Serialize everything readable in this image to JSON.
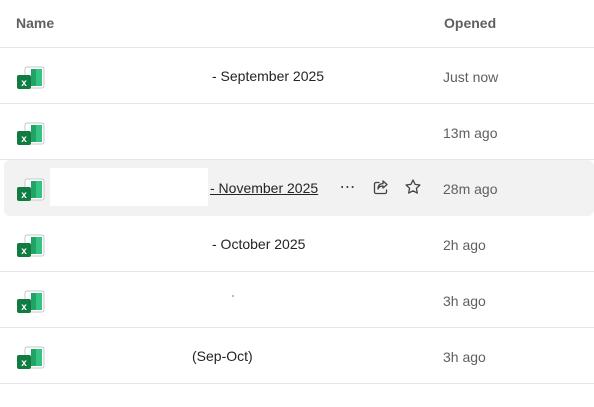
{
  "header": {
    "name_label": "Name",
    "opened_label": "Opened"
  },
  "files": [
    {
      "name": "- September 2025",
      "opened": "Just now",
      "icon": "excel-icon"
    },
    {
      "name": "",
      "opened": "13m ago",
      "icon": "excel-icon"
    },
    {
      "name": "- November 2025",
      "opened": "28m ago",
      "icon": "excel-icon"
    },
    {
      "name": "- October 2025",
      "opened": "2h ago",
      "icon": "excel-icon"
    },
    {
      "name": "",
      "opened": "3h ago",
      "icon": "excel-icon"
    },
    {
      "name": "(Sep-Oct)",
      "opened": "3h ago",
      "icon": "excel-icon"
    }
  ],
  "actions": {
    "more_icon": "more-horizontal-icon",
    "share_icon": "share-icon",
    "favorite_icon": "star-outline-icon"
  },
  "colors": {
    "excel_green": "#107c41",
    "excel_light": "#33c481",
    "hover_bg": "#f2f2f2",
    "divider": "#e6e6e6"
  }
}
